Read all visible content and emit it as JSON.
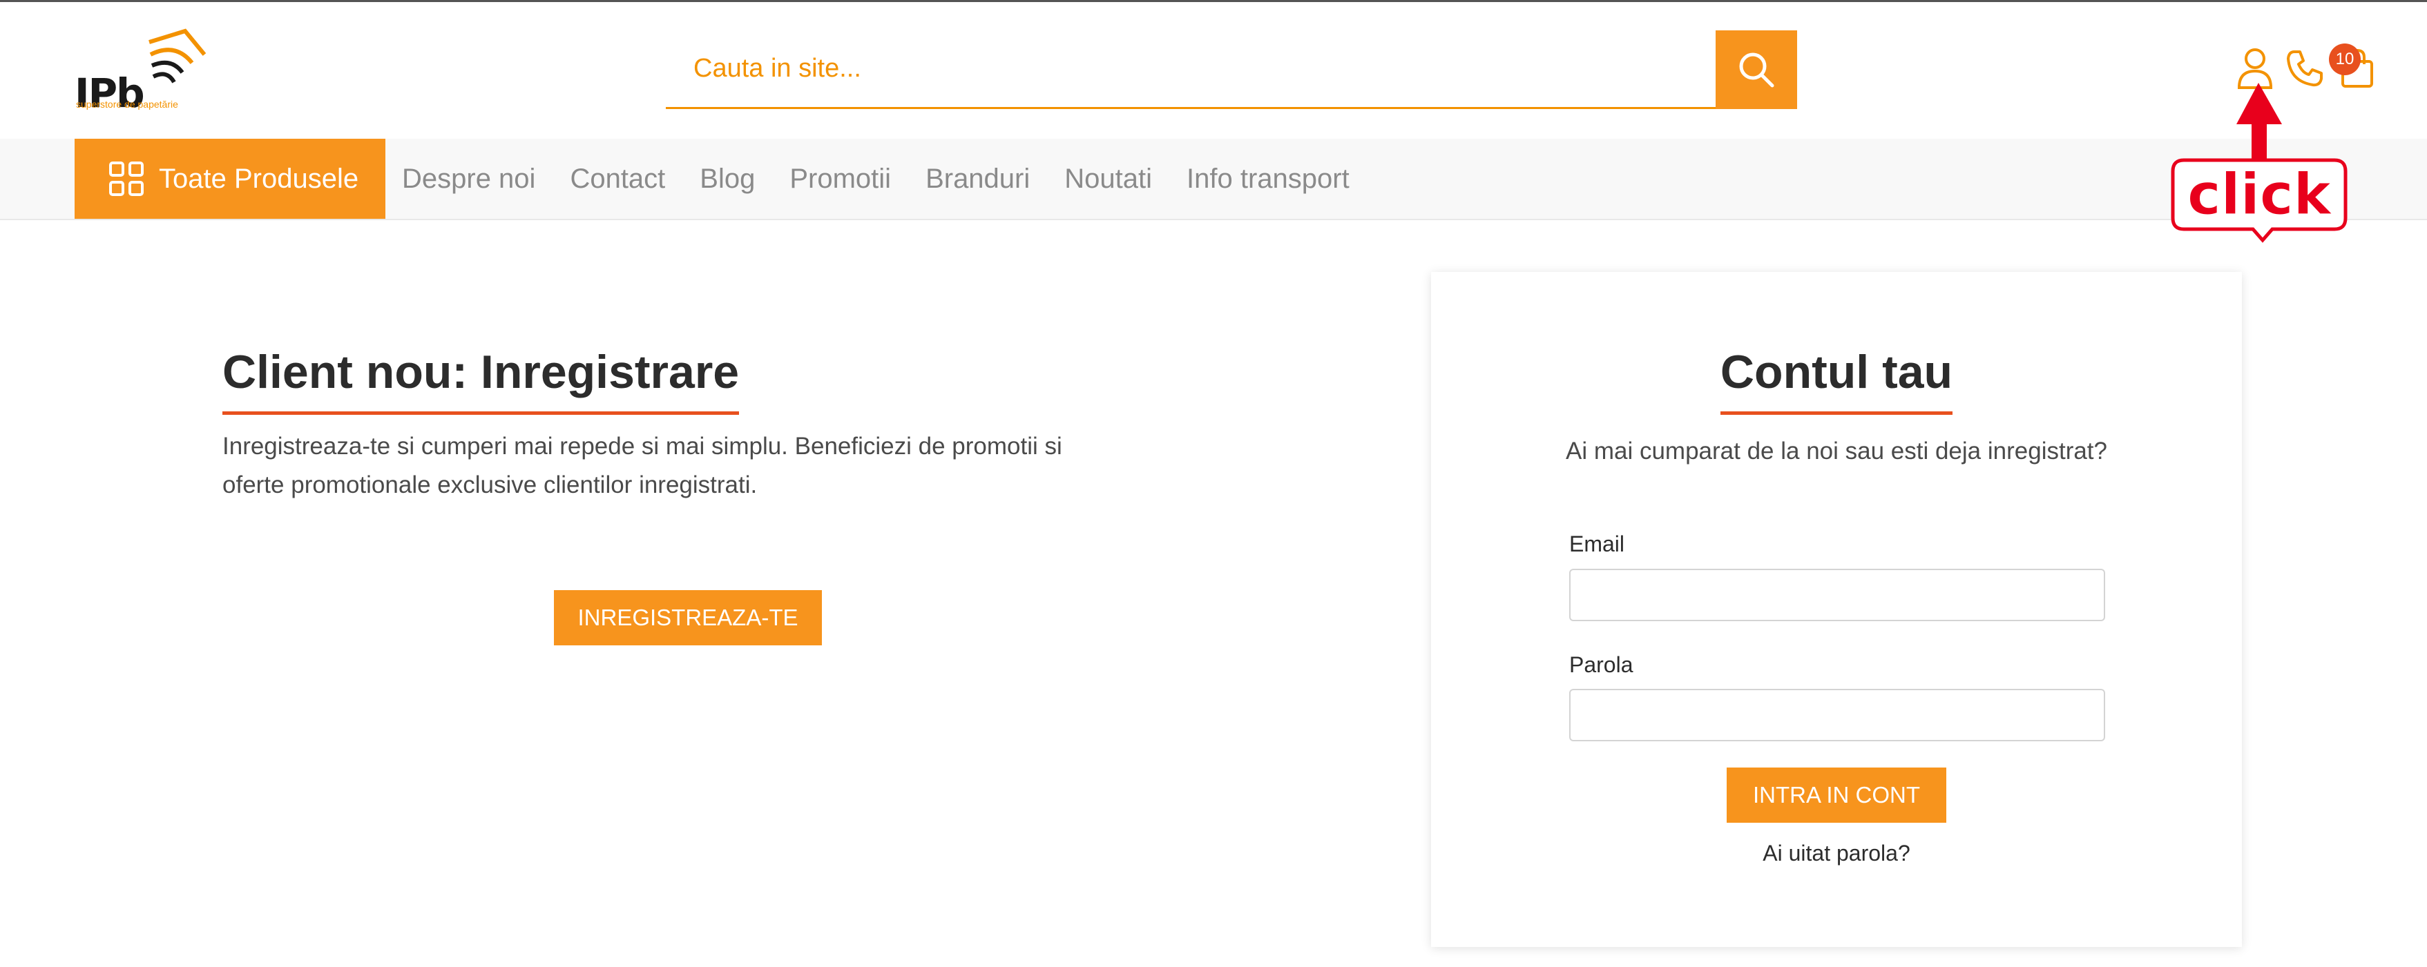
{
  "header": {
    "logo_text": "IPb",
    "logo_tagline": "superstore de papetărie",
    "search": {
      "placeholder": "Cauta in site..."
    },
    "cart_count": "10"
  },
  "nav": {
    "all_products_label": "Toate Produsele",
    "links": [
      "Despre noi",
      "Contact",
      "Blog",
      "Promotii",
      "Branduri",
      "Noutati",
      "Info transport"
    ]
  },
  "annotation": {
    "label": "click"
  },
  "register": {
    "title": "Client nou: Inregistrare",
    "description": "Inregistreaza-te si cumperi mai repede si mai simplu. Beneficiezi de promotii si oferte promotionale exclusive clientilor inregistrati.",
    "button_label": "INREGISTREAZA-TE"
  },
  "login": {
    "title": "Contul tau",
    "subtitle": "Ai mai cumparat de la noi sau esti deja inregistrat?",
    "email_label": "Email",
    "password_label": "Parola",
    "submit_label": "INTRA IN CONT",
    "forgot_label": "Ai uitat parola?"
  },
  "colors": {
    "accent": "#f7941d",
    "underline": "#e8501e",
    "nav_bg": "#f8f8f8",
    "annotation": "#e8001c"
  },
  "icons": [
    "search-icon",
    "user-icon",
    "phone-icon",
    "cart-icon",
    "grid-icon"
  ]
}
